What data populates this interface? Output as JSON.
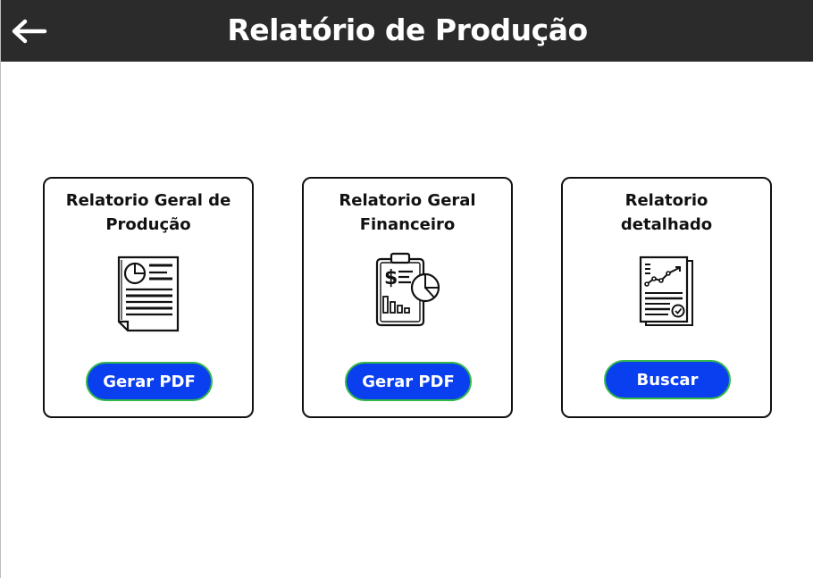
{
  "header": {
    "title": "Relatório de Produção",
    "back_icon": "arrow-left-icon",
    "background": "#2b2b2b"
  },
  "cards": [
    {
      "title": "Relatorio Geral de Produção",
      "icon": "report-document-icon",
      "button_label": "Gerar PDF"
    },
    {
      "title": "Relatorio Geral Financeiro",
      "icon": "financial-clipboard-icon",
      "button_label": "Gerar PDF"
    },
    {
      "title": "Relatorio detalhado",
      "icon": "detailed-chart-report-icon",
      "button_label": "Buscar"
    }
  ],
  "colors": {
    "button_fill": "#0a3ff0",
    "button_border": "#33b84a",
    "card_border": "#111111"
  }
}
